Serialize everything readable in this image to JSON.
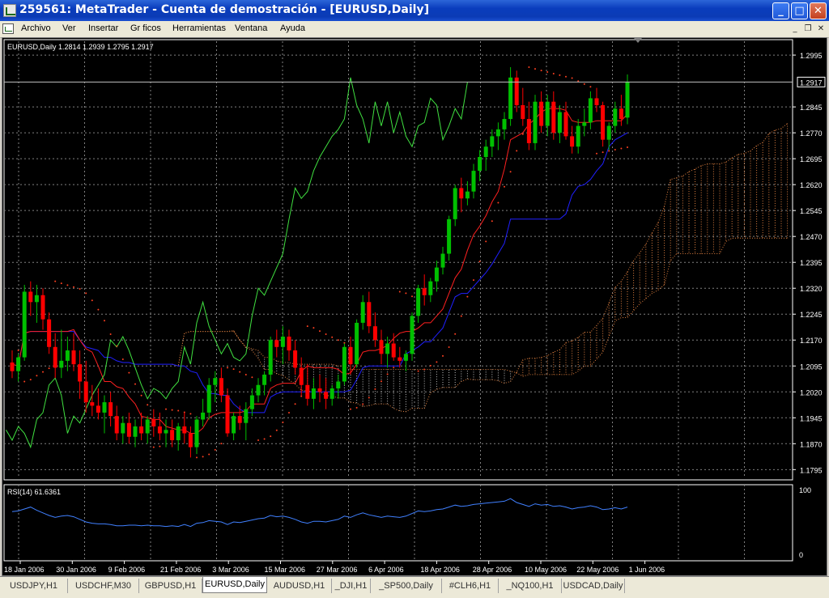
{
  "window": {
    "title": "259561: MetaTrader - Cuenta de demostración - [EURUSD,Daily]",
    "minimize_glyph": "_",
    "maximize_glyph": "□",
    "close_glyph": "✕"
  },
  "menu": {
    "items": [
      "Archivo",
      "Ver",
      "Insertar",
      "Gr ficos",
      "Herramientas",
      "Ventana",
      "Ayuda"
    ],
    "mdi_minimize": "_",
    "mdi_restore": "❐",
    "mdi_close": "✕"
  },
  "chart_data": {
    "type": "candlestick",
    "symbol_header": "EURUSD,Daily  1.2814 1.2939 1.2795 1.2917",
    "current_price_label": "1.2917",
    "current_price": 1.2917,
    "y_ticks": [
      "1.2995",
      "1.2917",
      "1.2845",
      "1.2770",
      "1.2695",
      "1.2620",
      "1.2545",
      "1.2470",
      "1.2395",
      "1.2320",
      "1.2245",
      "1.2170",
      "1.2095",
      "1.2020",
      "1.1945",
      "1.1870",
      "1.1795"
    ],
    "y_tick_values": [
      1.2995,
      1.2845,
      1.277,
      1.2695,
      1.262,
      1.2545,
      1.247,
      1.2395,
      1.232,
      1.2245,
      1.217,
      1.2095,
      1.202,
      1.1945,
      1.187,
      1.1795
    ],
    "ylim": [
      1.177,
      1.3035
    ],
    "x_labels": [
      "18 Jan 2006",
      "30 Jan 2006",
      "9 Feb 2006",
      "21 Feb 2006",
      "3 Mar 2006",
      "15 Mar 2006",
      "27 Mar 2006",
      "6 Apr 2006",
      "18 Apr 2006",
      "28 Apr 2006",
      "10 May 2006",
      "22 May 2006",
      "1 Jun 2006"
    ],
    "candles": [
      [
        1.2105,
        1.214,
        1.206,
        1.208
      ],
      [
        1.208,
        1.213,
        1.205,
        1.212
      ],
      [
        1.212,
        1.233,
        1.211,
        1.231
      ],
      [
        1.231,
        1.234,
        1.224,
        1.228
      ],
      [
        1.228,
        1.233,
        1.222,
        1.23
      ],
      [
        1.23,
        1.232,
        1.22,
        1.223
      ],
      [
        1.223,
        1.225,
        1.213,
        1.215
      ],
      [
        1.215,
        1.219,
        1.206,
        1.209
      ],
      [
        1.209,
        1.22,
        1.206,
        1.211
      ],
      [
        1.211,
        1.218,
        1.208,
        1.214
      ],
      [
        1.214,
        1.219,
        1.208,
        1.21
      ],
      [
        1.21,
        1.214,
        1.2,
        1.205
      ],
      [
        1.205,
        1.211,
        1.196,
        1.199
      ],
      [
        1.199,
        1.204,
        1.195,
        1.198
      ],
      [
        1.198,
        1.203,
        1.194,
        1.196
      ],
      [
        1.196,
        1.201,
        1.19,
        1.199
      ],
      [
        1.199,
        1.202,
        1.192,
        1.195
      ],
      [
        1.195,
        1.198,
        1.188,
        1.19
      ],
      [
        1.19,
        1.195,
        1.187,
        1.193
      ],
      [
        1.193,
        1.196,
        1.187,
        1.189
      ],
      [
        1.189,
        1.194,
        1.186,
        1.192
      ],
      [
        1.192,
        1.196,
        1.188,
        1.19
      ],
      [
        1.19,
        1.195,
        1.187,
        1.194
      ],
      [
        1.194,
        1.197,
        1.189,
        1.192
      ],
      [
        1.192,
        1.196,
        1.188,
        1.19
      ],
      [
        1.19,
        1.194,
        1.186,
        1.191
      ],
      [
        1.191,
        1.194,
        1.186,
        1.188
      ],
      [
        1.188,
        1.193,
        1.185,
        1.192
      ],
      [
        1.192,
        1.196,
        1.187,
        1.19
      ],
      [
        1.19,
        1.192,
        1.183,
        1.186
      ],
      [
        1.186,
        1.195,
        1.184,
        1.194
      ],
      [
        1.194,
        1.2,
        1.192,
        1.196
      ],
      [
        1.196,
        1.206,
        1.194,
        1.204
      ],
      [
        1.204,
        1.208,
        1.199,
        1.206
      ],
      [
        1.206,
        1.209,
        1.199,
        1.201
      ],
      [
        1.201,
        1.203,
        1.189,
        1.19
      ],
      [
        1.19,
        1.196,
        1.188,
        1.195
      ],
      [
        1.195,
        1.198,
        1.191,
        1.193
      ],
      [
        1.193,
        1.199,
        1.188,
        1.197
      ],
      [
        1.197,
        1.203,
        1.195,
        1.201
      ],
      [
        1.201,
        1.206,
        1.199,
        1.204
      ],
      [
        1.204,
        1.208,
        1.201,
        1.207
      ],
      [
        1.207,
        1.218,
        1.205,
        1.217
      ],
      [
        1.217,
        1.22,
        1.212,
        1.215
      ],
      [
        1.215,
        1.221,
        1.21,
        1.218
      ],
      [
        1.218,
        1.22,
        1.211,
        1.214
      ],
      [
        1.214,
        1.217,
        1.207,
        1.209
      ],
      [
        1.209,
        1.212,
        1.201,
        1.204
      ],
      [
        1.204,
        1.21,
        1.198,
        1.2
      ],
      [
        1.2,
        1.206,
        1.197,
        1.203
      ],
      [
        1.203,
        1.207,
        1.199,
        1.202
      ],
      [
        1.202,
        1.206,
        1.197,
        1.2
      ],
      [
        1.2,
        1.204,
        1.198,
        1.203
      ],
      [
        1.203,
        1.207,
        1.2,
        1.205
      ],
      [
        1.205,
        1.216,
        1.204,
        1.215
      ],
      [
        1.215,
        1.218,
        1.207,
        1.21
      ],
      [
        1.21,
        1.223,
        1.209,
        1.222
      ],
      [
        1.222,
        1.23,
        1.22,
        1.228
      ],
      [
        1.228,
        1.231,
        1.219,
        1.221
      ],
      [
        1.221,
        1.225,
        1.215,
        1.217
      ],
      [
        1.217,
        1.22,
        1.21,
        1.213
      ],
      [
        1.213,
        1.218,
        1.209,
        1.216
      ],
      [
        1.216,
        1.219,
        1.211,
        1.212
      ],
      [
        1.212,
        1.215,
        1.209,
        1.211
      ],
      [
        1.211,
        1.214,
        1.208,
        1.213
      ],
      [
        1.213,
        1.225,
        1.211,
        1.224
      ],
      [
        1.224,
        1.233,
        1.222,
        1.232
      ],
      [
        1.232,
        1.236,
        1.227,
        1.23
      ],
      [
        1.23,
        1.235,
        1.228,
        1.234
      ],
      [
        1.234,
        1.24,
        1.231,
        1.238
      ],
      [
        1.238,
        1.244,
        1.236,
        1.242
      ],
      [
        1.242,
        1.253,
        1.24,
        1.252
      ],
      [
        1.252,
        1.262,
        1.25,
        1.261
      ],
      [
        1.261,
        1.264,
        1.254,
        1.258
      ],
      [
        1.258,
        1.263,
        1.256,
        1.26
      ],
      [
        1.26,
        1.268,
        1.258,
        1.266
      ],
      [
        1.266,
        1.272,
        1.263,
        1.27
      ],
      [
        1.27,
        1.275,
        1.266,
        1.273
      ],
      [
        1.273,
        1.278,
        1.27,
        1.276
      ],
      [
        1.276,
        1.28,
        1.272,
        1.278
      ],
      [
        1.278,
        1.283,
        1.275,
        1.281
      ],
      [
        1.281,
        1.296,
        1.279,
        1.293
      ],
      [
        1.293,
        1.295,
        1.283,
        1.285
      ],
      [
        1.285,
        1.29,
        1.279,
        1.281
      ],
      [
        1.281,
        1.286,
        1.272,
        1.274
      ],
      [
        1.274,
        1.288,
        1.272,
        1.286
      ],
      [
        1.286,
        1.289,
        1.277,
        1.279
      ],
      [
        1.279,
        1.288,
        1.276,
        1.286
      ],
      [
        1.286,
        1.289,
        1.275,
        1.277
      ],
      [
        1.277,
        1.285,
        1.274,
        1.283
      ],
      [
        1.283,
        1.286,
        1.275,
        1.276
      ],
      [
        1.276,
        1.279,
        1.271,
        1.273
      ],
      [
        1.273,
        1.281,
        1.271,
        1.279
      ],
      [
        1.279,
        1.284,
        1.276,
        1.28
      ],
      [
        1.28,
        1.289,
        1.278,
        1.287
      ],
      [
        1.287,
        1.29,
        1.283,
        1.285
      ],
      [
        1.285,
        1.286,
        1.273,
        1.275
      ],
      [
        1.275,
        1.28,
        1.272,
        1.279
      ],
      [
        1.279,
        1.286,
        1.277,
        1.284
      ],
      [
        1.284,
        1.288,
        1.279,
        1.281
      ],
      [
        1.2814,
        1.2939,
        1.2795,
        1.2917
      ]
    ],
    "rsi": {
      "label": "RSI(14) 61.6361",
      "scale_labels": [
        "100",
        "0"
      ],
      "values": [
        66,
        67,
        70,
        73,
        68,
        64,
        60,
        57,
        59,
        60,
        58,
        54,
        50,
        48,
        47,
        47,
        46,
        44,
        44,
        45,
        45,
        44,
        45,
        44,
        44,
        43,
        44,
        43,
        46,
        43,
        48,
        49,
        52,
        51,
        50,
        46,
        50,
        49,
        51,
        53,
        55,
        56,
        60,
        58,
        59,
        57,
        54,
        50,
        48,
        51,
        51,
        50,
        52,
        54,
        59,
        57,
        61,
        64,
        61,
        59,
        57,
        59,
        58,
        57,
        59,
        63,
        67,
        66,
        67,
        69,
        70,
        73,
        76,
        74,
        75,
        77,
        78,
        79,
        80,
        81,
        82,
        86,
        80,
        77,
        74,
        78,
        76,
        77,
        74,
        75,
        73,
        70,
        72,
        73,
        75,
        73,
        69,
        70,
        72,
        70,
        73
      ]
    },
    "indicators": {
      "ichimoku": "Ichimoku Kinko Hyo (Tenkan red, Kijun blue, Chikou green, Kumo cloud hatched)",
      "parabolic_sar": "dotted"
    }
  },
  "tabs": [
    "USDJPY,H1",
    "USDCHF,M30",
    "GBPUSD,H1",
    "EURUSD,Daily",
    "AUDUSD,H1",
    "_DJI,H1",
    "_SP500,Daily",
    "#CLH6,H1",
    "_NQ100,H1",
    "USDCAD,Daily"
  ],
  "active_tab": "EURUSD,Daily",
  "colors": {
    "background": "#000000",
    "grid": "#808080",
    "bull": "#00c000",
    "bear": "#ff0000",
    "tenkan": "#ff2020",
    "kijun": "#2020ff",
    "chikou": "#40e040",
    "sar": "#ff4020",
    "cloud_up": "#e08040",
    "cloud_down": "#c0c0c0",
    "rsi_line": "#4080ff"
  }
}
